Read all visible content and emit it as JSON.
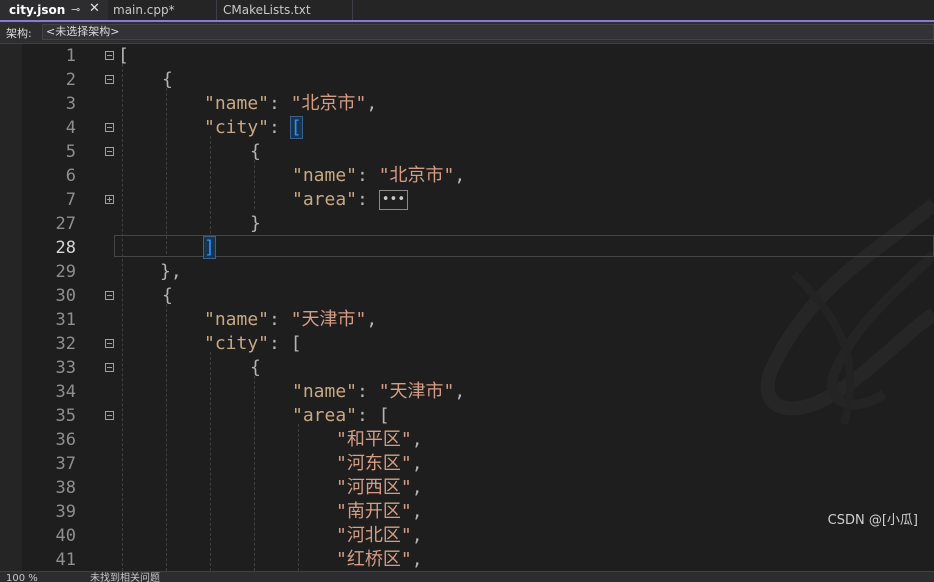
{
  "tabs": [
    {
      "label": "city.json",
      "pin": "⊸",
      "close": "✕"
    },
    {
      "label": "main.cpp*"
    },
    {
      "label": "CMakeLists.txt"
    }
  ],
  "navbar": {
    "label": "架构:",
    "value": "<未选择架构>"
  },
  "icons": {
    "fold_collapse": "minus-box",
    "fold_expand": "plus-box",
    "collapsed": "ellipsis-box"
  },
  "colors": {
    "accent": "#8b7bd8",
    "key": "#c8a882",
    "string": "#d69d85",
    "bracket_highlight": "#2f8fff"
  },
  "lines": [
    {
      "num": "1",
      "tokens": [
        {
          "t": "[",
          "c": "p"
        }
      ]
    },
    {
      "num": "2",
      "tokens": [
        {
          "t": "{",
          "c": "p"
        }
      ]
    },
    {
      "num": "3",
      "tokens": [
        {
          "t": "\"name\"",
          "c": "k"
        },
        {
          "t": ": ",
          "c": "p"
        },
        {
          "t": "\"北京市\"",
          "c": "s"
        },
        {
          "t": ",",
          "c": "p"
        }
      ]
    },
    {
      "num": "4",
      "tokens": [
        {
          "t": "\"city\"",
          "c": "k"
        },
        {
          "t": ": ",
          "c": "p"
        },
        {
          "t": "[",
          "c": "brk"
        }
      ]
    },
    {
      "num": "5",
      "tokens": [
        {
          "t": "{",
          "c": "p"
        }
      ]
    },
    {
      "num": "6",
      "tokens": [
        {
          "t": "\"name\"",
          "c": "k"
        },
        {
          "t": ": ",
          "c": "p"
        },
        {
          "t": "\"北京市\"",
          "c": "s"
        },
        {
          "t": ",",
          "c": "p"
        }
      ]
    },
    {
      "num": "7",
      "tokens": [
        {
          "t": "\"area\"",
          "c": "k"
        },
        {
          "t": ": ",
          "c": "p"
        },
        {
          "t": "•••",
          "c": "collapsed"
        }
      ]
    },
    {
      "num": "27",
      "tokens": [
        {
          "t": "}",
          "c": "p"
        }
      ]
    },
    {
      "num": "28",
      "tokens": [
        {
          "t": "]",
          "c": "brk"
        }
      ]
    },
    {
      "num": "29",
      "tokens": [
        {
          "t": "},",
          "c": "p"
        }
      ]
    },
    {
      "num": "30",
      "tokens": [
        {
          "t": "{",
          "c": "p"
        }
      ]
    },
    {
      "num": "31",
      "tokens": [
        {
          "t": "\"name\"",
          "c": "k"
        },
        {
          "t": ": ",
          "c": "p"
        },
        {
          "t": "\"天津市\"",
          "c": "s"
        },
        {
          "t": ",",
          "c": "p"
        }
      ]
    },
    {
      "num": "32",
      "tokens": [
        {
          "t": "\"city\"",
          "c": "k"
        },
        {
          "t": ": ",
          "c": "p"
        },
        {
          "t": "[",
          "c": "p"
        }
      ]
    },
    {
      "num": "33",
      "tokens": [
        {
          "t": "{",
          "c": "p"
        }
      ]
    },
    {
      "num": "34",
      "tokens": [
        {
          "t": "\"name\"",
          "c": "k"
        },
        {
          "t": ": ",
          "c": "p"
        },
        {
          "t": "\"天津市\"",
          "c": "s"
        },
        {
          "t": ",",
          "c": "p"
        }
      ]
    },
    {
      "num": "35",
      "tokens": [
        {
          "t": "\"area\"",
          "c": "k"
        },
        {
          "t": ": ",
          "c": "p"
        },
        {
          "t": "[",
          "c": "p"
        }
      ]
    },
    {
      "num": "36",
      "tokens": [
        {
          "t": "\"和平区\"",
          "c": "s"
        },
        {
          "t": ",",
          "c": "p"
        }
      ]
    },
    {
      "num": "37",
      "tokens": [
        {
          "t": "\"河东区\"",
          "c": "s"
        },
        {
          "t": ",",
          "c": "p"
        }
      ]
    },
    {
      "num": "38",
      "tokens": [
        {
          "t": "\"河西区\"",
          "c": "s"
        },
        {
          "t": ",",
          "c": "p"
        }
      ]
    },
    {
      "num": "39",
      "tokens": [
        {
          "t": "\"南开区\"",
          "c": "s"
        },
        {
          "t": ",",
          "c": "p"
        }
      ]
    },
    {
      "num": "40",
      "tokens": [
        {
          "t": "\"河北区\"",
          "c": "s"
        },
        {
          "t": ",",
          "c": "p"
        }
      ]
    },
    {
      "num": "41",
      "tokens": [
        {
          "t": "\"红桥区\"",
          "c": "s"
        },
        {
          "t": ",",
          "c": "p"
        }
      ]
    }
  ],
  "status": {
    "zoom": "100 %",
    "issues": "未找到相关问题"
  },
  "watermark": "CSDN @[小瓜]"
}
